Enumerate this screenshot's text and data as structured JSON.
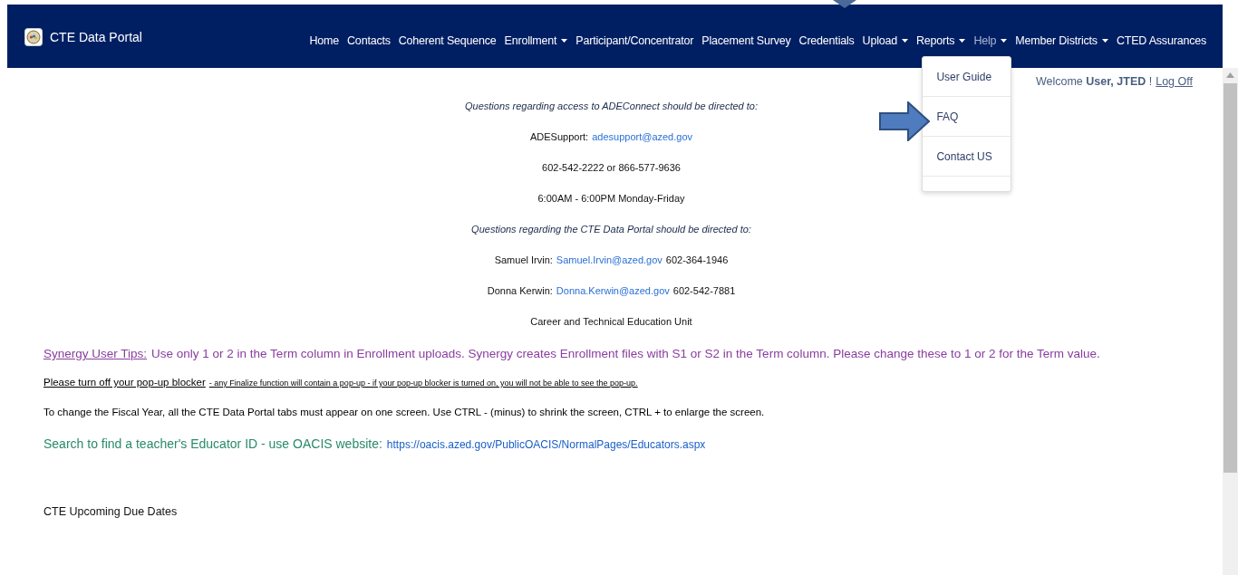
{
  "brand": {
    "title": "CTE Data Portal"
  },
  "nav": [
    {
      "label": "Home",
      "caret": false,
      "selected": false
    },
    {
      "label": "Contacts",
      "caret": false,
      "selected": false
    },
    {
      "label": "Coherent Sequence",
      "caret": false,
      "selected": false
    },
    {
      "label": "Enrollment",
      "caret": true,
      "selected": false
    },
    {
      "label": "Participant/Concentrator",
      "caret": false,
      "selected": false
    },
    {
      "label": "Placement Survey",
      "caret": false,
      "selected": false
    },
    {
      "label": "Credentials",
      "caret": false,
      "selected": false
    },
    {
      "label": "Upload",
      "caret": true,
      "selected": false
    },
    {
      "label": "Reports",
      "caret": true,
      "selected": false
    },
    {
      "label": "Help",
      "caret": true,
      "selected": true
    },
    {
      "label": "Member Districts",
      "caret": true,
      "selected": false
    },
    {
      "label": "CTED Assurances",
      "caret": false,
      "selected": false
    }
  ],
  "help_menu": [
    "User Guide",
    "FAQ",
    "Contact US"
  ],
  "welcome": {
    "text": "Welcome **User, JTED** !",
    "link": "Log Off"
  },
  "contact_lines": [
    {
      "kind": "italic",
      "text": "Questions regarding access to ADEConnect should be directed to:"
    },
    {
      "kind": "contact",
      "text": "ADESupport:",
      "email": "adesupport@azed.gov"
    },
    {
      "kind": "plain",
      "text": "602-542-2222 or 866-577-9636"
    },
    {
      "kind": "plain",
      "text": "6:00AM - 6:00PM Monday-Friday"
    },
    {
      "kind": "italic",
      "text": "Questions regarding the CTE Data Portal should be directed to:"
    },
    {
      "kind": "contact",
      "text": "Samuel Irvin:",
      "email": "Samuel.Irvin@azed.gov",
      "phone": "602-364-1946"
    },
    {
      "kind": "contact",
      "text": "Donna Kerwin:",
      "email": "Donna.Kerwin@azed.gov",
      "phone": "602-542-7881"
    },
    {
      "kind": "plain",
      "text": "Career and Technical Education Unit"
    }
  ],
  "synergy": {
    "label": "Synergy User Tips:",
    "text": "Use only 1 or 2 in the Term column in Enrollment uploads. Synergy creates Enrollment files with S1 or S2 in the Term column. Please change these to 1 or 2 for the Term value."
  },
  "popup": {
    "lead": "Please turn off your pop-up blocker",
    "text": "- any Finalize function will contain a pop-up - if your pop-up blocker is turned on, you will not be able to see the pop-up."
  },
  "fiscal_note": "To change the Fiscal Year, all the CTE Data Portal tabs must appear on one screen. Use CTRL - (minus)  to shrink the screen, CTRL + to enlarge the screen.",
  "educator": {
    "text": "Search to find a teacher's Educator ID - use  OACIS website:",
    "link": "https://oacis.azed.gov/PublicOACIS/NormalPages/Educators.aspx"
  },
  "due_dates_heading": "CTE Upcoming Due Dates"
}
